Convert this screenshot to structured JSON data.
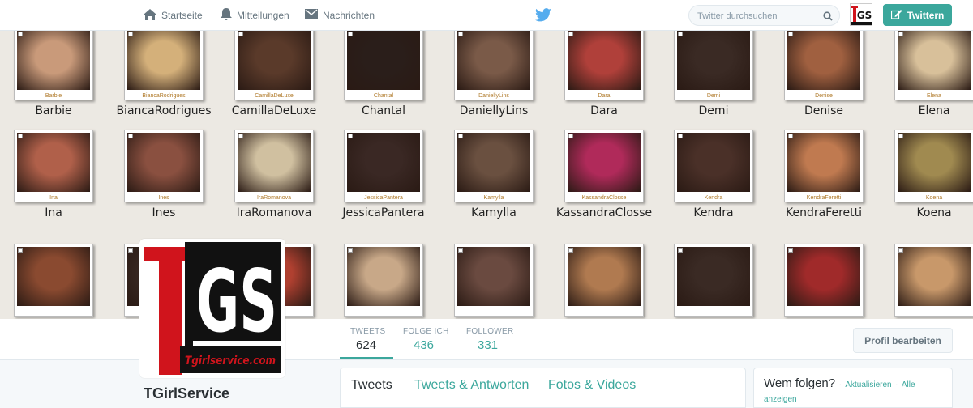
{
  "nav": {
    "home": "Startseite",
    "notifications": "Mitteilungen",
    "messages": "Nachrichten",
    "search_placeholder": "Twitter durchsuchen",
    "tweet_button": "Twittern"
  },
  "banner": {
    "row1": [
      "Barbie",
      "BiancaRodrigues",
      "CamillaDeLuxe",
      "Chantal",
      "DaniellyLins",
      "Dara",
      "Demi",
      "Denise",
      "Elena"
    ],
    "row2": [
      "Ina",
      "Ines",
      "IraRomanova",
      "JessicaPantera",
      "Kamylla",
      "KassandraClosse",
      "Kendra",
      "KendraFeretti",
      "Koena"
    ]
  },
  "profile_logo": {
    "letters_1": "T",
    "letters_2": "GS",
    "site": "Tgirlservice.com"
  },
  "stats": [
    {
      "label": "TWEETS",
      "value": "624"
    },
    {
      "label": "FOLGE ICH",
      "value": "436"
    },
    {
      "label": "FOLLOWER",
      "value": "331"
    }
  ],
  "edit_profile": "Profil bearbeiten",
  "profile_name": "TGirlService",
  "tabs": [
    "Tweets",
    "Tweets & Antworten",
    "Fotos & Videos"
  ],
  "who_to_follow": {
    "title": "Wem folgen?",
    "separator": "·",
    "refresh": "Aktualisieren",
    "view_all": "Alle anzeigen"
  },
  "colors": {
    "accent": "#3ba79c",
    "twitter_blue": "#55acee",
    "text": "#292f33",
    "muted": "#8899a6"
  }
}
